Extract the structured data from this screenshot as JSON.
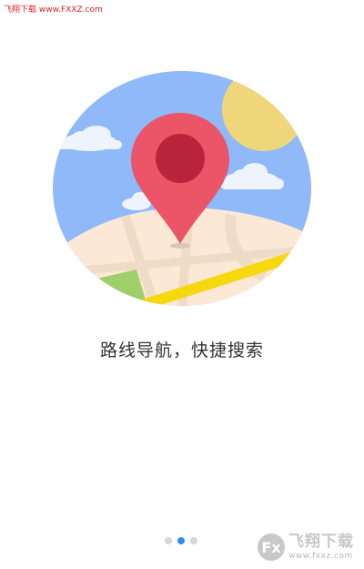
{
  "watermark_top": "飞翔下载 www.FXXZ.com",
  "slogan": "路线导航，快捷搜索",
  "pagination": {
    "count": 3,
    "active_index": 1
  },
  "watermark_bottom": {
    "logo_glyph": "Fx",
    "title": "飞翔下载",
    "url": "www.fxxz.com"
  },
  "colors": {
    "sky": "#8fb9f8",
    "sun": "#f0d67a",
    "pin": "#ec5468",
    "pin_center": "#b8253a",
    "road": "#f6d80f",
    "ground": "#fbe9d6",
    "grass": "#9fcf6a",
    "dot_active": "#2f8ff0",
    "dot_inactive": "#d6d6d6"
  }
}
